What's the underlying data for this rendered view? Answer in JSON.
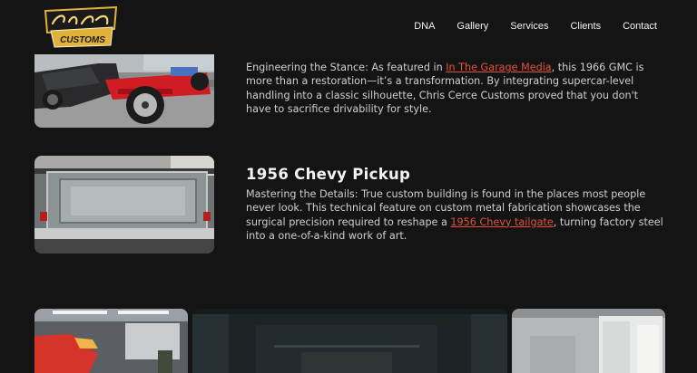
{
  "header": {
    "logo_text_top": "Chris Cerce",
    "logo_text_bottom": "CUSTOMS",
    "nav": [
      {
        "label": "DNA"
      },
      {
        "label": "Gallery"
      },
      {
        "label": "Services"
      },
      {
        "label": "Clients"
      },
      {
        "label": "Contact"
      }
    ]
  },
  "features": [
    {
      "image": "1966 GMC on red chassis in shop",
      "body_before": "Engineering the Stance: As featured in ",
      "link": "In The Garage Media",
      "body_after": ", this 1966 GMC is more than a restoration—it’s a transformation. By integrating supercar-level handling into a classic silhouette, Chris Cerce Customs proved that you don't have to sacrifice drivability for style."
    },
    {
      "image": "Custom fabricated tailgate",
      "title": "1956 Chevy Pickup",
      "body_before": "Mastering the Details: True custom building is found in the places most people never look. This technical feature on custom metal fabrication showcases the surgical precision required to reshape a ",
      "link": "1956 Chevy tailgate",
      "body_after": ", turning factory steel into a one-of-a-kind work of art."
    }
  ],
  "colors": {
    "background": "#141414",
    "link": "#e3513b",
    "logo_gold": "#e0b23a"
  }
}
